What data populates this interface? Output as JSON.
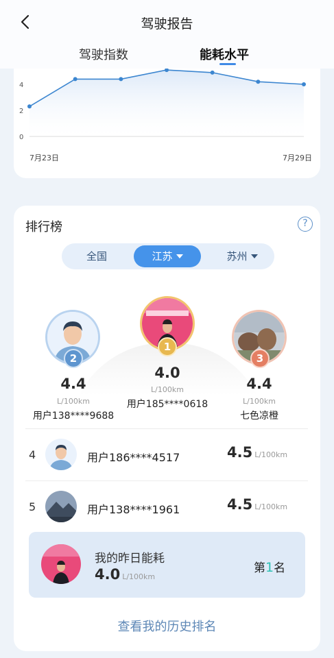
{
  "header": {
    "title": "驾驶报告",
    "back_icon": "chevron-left-icon"
  },
  "tabs": [
    {
      "label": "驾驶指数",
      "active": false
    },
    {
      "label": "能耗水平",
      "active": true
    }
  ],
  "chart_data": {
    "type": "area",
    "y_ticks": [
      "4",
      "2",
      "0"
    ],
    "x_labels": [
      "7月23日",
      "7月29日"
    ],
    "x": [
      "7月23日",
      "7月24日",
      "7月25日",
      "7月26日",
      "7月27日",
      "7月28日",
      "7月29日"
    ],
    "values": [
      2.3,
      4.4,
      4.4,
      5.1,
      4.9,
      4.2,
      4.0
    ],
    "ylim": [
      0,
      5
    ],
    "line_color": "#3c86d0",
    "fill_color": "#dde9f8"
  },
  "ranking": {
    "title": "排行榜",
    "help_icon": "?",
    "regions": [
      {
        "label": "全国"
      },
      {
        "label": "江苏",
        "active": true
      },
      {
        "label": "苏州"
      }
    ],
    "podium": [
      {
        "rank": "2",
        "value": "4.4",
        "unit": "L/100km",
        "name": "用户138****9688"
      },
      {
        "rank": "1",
        "value": "4.0",
        "unit": "L/100km",
        "name": "用户185****0618"
      },
      {
        "rank": "3",
        "value": "4.4",
        "unit": "L/100km",
        "name": "七色凉橙"
      }
    ],
    "list": [
      {
        "rank": "4",
        "name": "用户186****4517",
        "value": "4.5",
        "unit": "L/100km"
      },
      {
        "rank": "5",
        "name": "用户138****1961",
        "value": "4.5",
        "unit": "L/100km"
      }
    ],
    "mine": {
      "label": "我的昨日能耗",
      "value": "4.0",
      "unit": "L/100km",
      "rank_prefix": "第",
      "rank": "1",
      "rank_suffix": "名"
    },
    "history_link": "查看我的历史排名"
  },
  "colors": {
    "accent": "#4593ea",
    "rank_highlight": "#2bc0b4",
    "background": "#eef3f9"
  }
}
